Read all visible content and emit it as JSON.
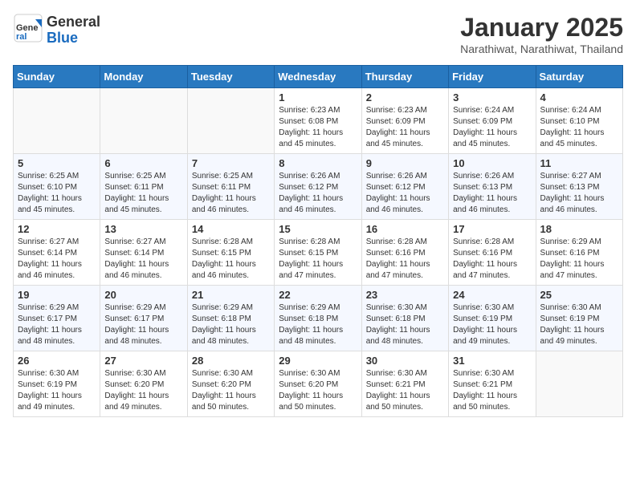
{
  "logo": {
    "general": "General",
    "blue": "Blue"
  },
  "header": {
    "month": "January 2025",
    "location": "Narathiwat, Narathiwat, Thailand"
  },
  "weekdays": [
    "Sunday",
    "Monday",
    "Tuesday",
    "Wednesday",
    "Thursday",
    "Friday",
    "Saturday"
  ],
  "weeks": [
    [
      {
        "day": "",
        "info": ""
      },
      {
        "day": "",
        "info": ""
      },
      {
        "day": "",
        "info": ""
      },
      {
        "day": "1",
        "info": "Sunrise: 6:23 AM\nSunset: 6:08 PM\nDaylight: 11 hours and 45 minutes."
      },
      {
        "day": "2",
        "info": "Sunrise: 6:23 AM\nSunset: 6:09 PM\nDaylight: 11 hours and 45 minutes."
      },
      {
        "day": "3",
        "info": "Sunrise: 6:24 AM\nSunset: 6:09 PM\nDaylight: 11 hours and 45 minutes."
      },
      {
        "day": "4",
        "info": "Sunrise: 6:24 AM\nSunset: 6:10 PM\nDaylight: 11 hours and 45 minutes."
      }
    ],
    [
      {
        "day": "5",
        "info": "Sunrise: 6:25 AM\nSunset: 6:10 PM\nDaylight: 11 hours and 45 minutes."
      },
      {
        "day": "6",
        "info": "Sunrise: 6:25 AM\nSunset: 6:11 PM\nDaylight: 11 hours and 45 minutes."
      },
      {
        "day": "7",
        "info": "Sunrise: 6:25 AM\nSunset: 6:11 PM\nDaylight: 11 hours and 46 minutes."
      },
      {
        "day": "8",
        "info": "Sunrise: 6:26 AM\nSunset: 6:12 PM\nDaylight: 11 hours and 46 minutes."
      },
      {
        "day": "9",
        "info": "Sunrise: 6:26 AM\nSunset: 6:12 PM\nDaylight: 11 hours and 46 minutes."
      },
      {
        "day": "10",
        "info": "Sunrise: 6:26 AM\nSunset: 6:13 PM\nDaylight: 11 hours and 46 minutes."
      },
      {
        "day": "11",
        "info": "Sunrise: 6:27 AM\nSunset: 6:13 PM\nDaylight: 11 hours and 46 minutes."
      }
    ],
    [
      {
        "day": "12",
        "info": "Sunrise: 6:27 AM\nSunset: 6:14 PM\nDaylight: 11 hours and 46 minutes."
      },
      {
        "day": "13",
        "info": "Sunrise: 6:27 AM\nSunset: 6:14 PM\nDaylight: 11 hours and 46 minutes."
      },
      {
        "day": "14",
        "info": "Sunrise: 6:28 AM\nSunset: 6:15 PM\nDaylight: 11 hours and 46 minutes."
      },
      {
        "day": "15",
        "info": "Sunrise: 6:28 AM\nSunset: 6:15 PM\nDaylight: 11 hours and 47 minutes."
      },
      {
        "day": "16",
        "info": "Sunrise: 6:28 AM\nSunset: 6:16 PM\nDaylight: 11 hours and 47 minutes."
      },
      {
        "day": "17",
        "info": "Sunrise: 6:28 AM\nSunset: 6:16 PM\nDaylight: 11 hours and 47 minutes."
      },
      {
        "day": "18",
        "info": "Sunrise: 6:29 AM\nSunset: 6:16 PM\nDaylight: 11 hours and 47 minutes."
      }
    ],
    [
      {
        "day": "19",
        "info": "Sunrise: 6:29 AM\nSunset: 6:17 PM\nDaylight: 11 hours and 48 minutes."
      },
      {
        "day": "20",
        "info": "Sunrise: 6:29 AM\nSunset: 6:17 PM\nDaylight: 11 hours and 48 minutes."
      },
      {
        "day": "21",
        "info": "Sunrise: 6:29 AM\nSunset: 6:18 PM\nDaylight: 11 hours and 48 minutes."
      },
      {
        "day": "22",
        "info": "Sunrise: 6:29 AM\nSunset: 6:18 PM\nDaylight: 11 hours and 48 minutes."
      },
      {
        "day": "23",
        "info": "Sunrise: 6:30 AM\nSunset: 6:18 PM\nDaylight: 11 hours and 48 minutes."
      },
      {
        "day": "24",
        "info": "Sunrise: 6:30 AM\nSunset: 6:19 PM\nDaylight: 11 hours and 49 minutes."
      },
      {
        "day": "25",
        "info": "Sunrise: 6:30 AM\nSunset: 6:19 PM\nDaylight: 11 hours and 49 minutes."
      }
    ],
    [
      {
        "day": "26",
        "info": "Sunrise: 6:30 AM\nSunset: 6:19 PM\nDaylight: 11 hours and 49 minutes."
      },
      {
        "day": "27",
        "info": "Sunrise: 6:30 AM\nSunset: 6:20 PM\nDaylight: 11 hours and 49 minutes."
      },
      {
        "day": "28",
        "info": "Sunrise: 6:30 AM\nSunset: 6:20 PM\nDaylight: 11 hours and 50 minutes."
      },
      {
        "day": "29",
        "info": "Sunrise: 6:30 AM\nSunset: 6:20 PM\nDaylight: 11 hours and 50 minutes."
      },
      {
        "day": "30",
        "info": "Sunrise: 6:30 AM\nSunset: 6:21 PM\nDaylight: 11 hours and 50 minutes."
      },
      {
        "day": "31",
        "info": "Sunrise: 6:30 AM\nSunset: 6:21 PM\nDaylight: 11 hours and 50 minutes."
      },
      {
        "day": "",
        "info": ""
      }
    ]
  ]
}
